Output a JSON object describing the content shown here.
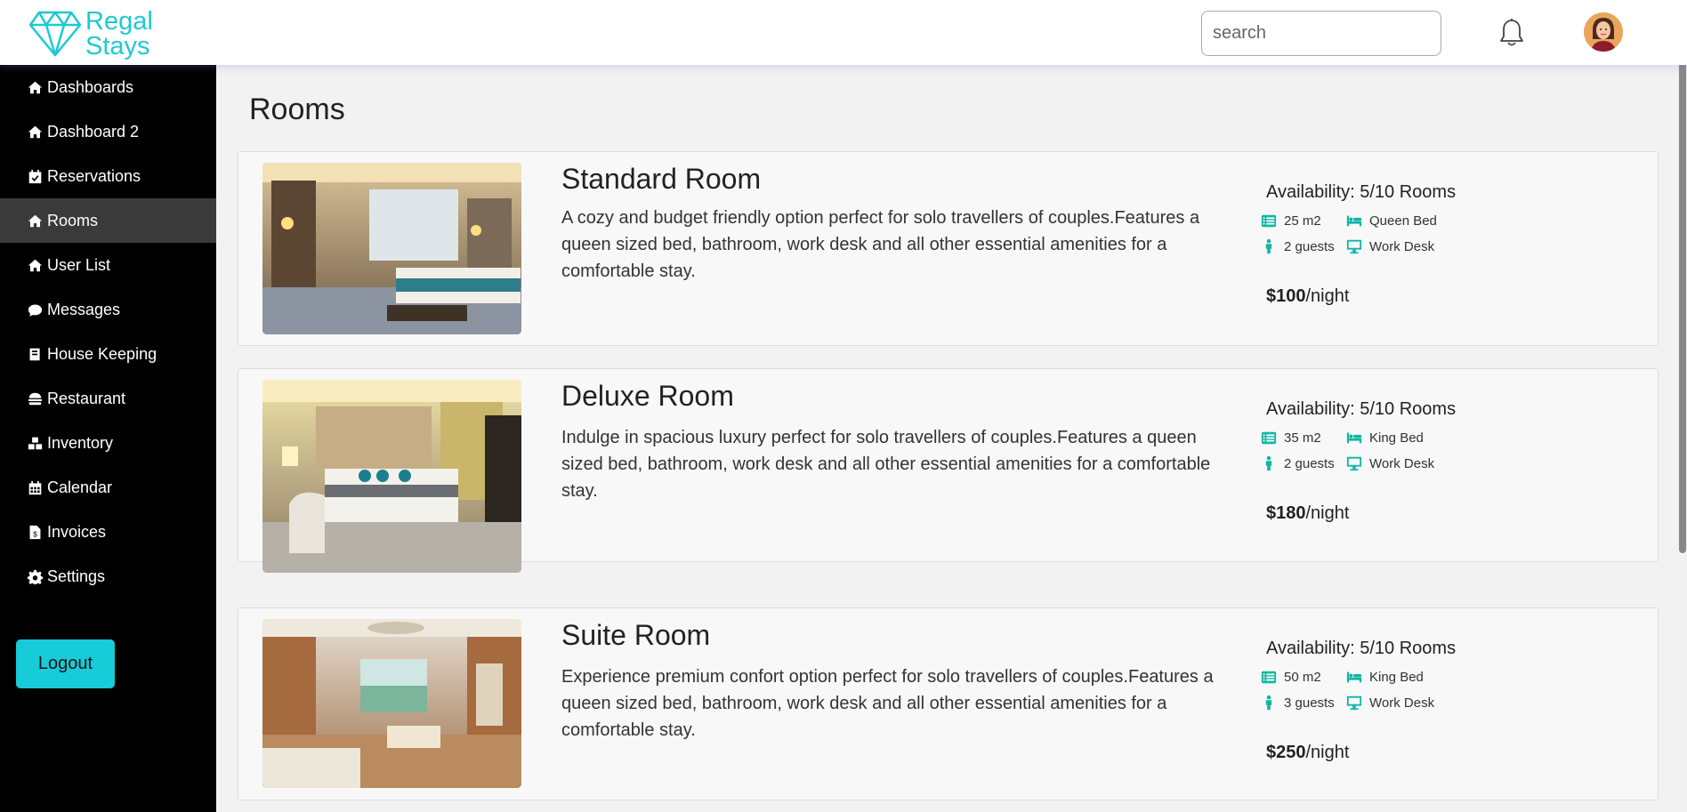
{
  "brand": {
    "line1": "Regal",
    "line2": "Stays",
    "color": "#1ec9d3"
  },
  "search": {
    "placeholder": "search"
  },
  "sidebar": {
    "items": [
      {
        "label": "Dashboards",
        "icon": "home-icon"
      },
      {
        "label": "Dashboard 2",
        "icon": "home-icon"
      },
      {
        "label": "Reservations",
        "icon": "calendar-check-icon"
      },
      {
        "label": "Rooms",
        "icon": "home-icon",
        "active": true
      },
      {
        "label": "User List",
        "icon": "home-icon"
      },
      {
        "label": "Messages",
        "icon": "chat-bubble-icon"
      },
      {
        "label": "House Keeping",
        "icon": "book-icon"
      },
      {
        "label": "Restaurant",
        "icon": "burger-icon"
      },
      {
        "label": "Inventory",
        "icon": "boxes-icon"
      },
      {
        "label": "Calendar",
        "icon": "calendar-icon"
      },
      {
        "label": "Invoices",
        "icon": "invoice-icon"
      },
      {
        "label": "Settings",
        "icon": "gear-icon"
      }
    ],
    "logout_label": "Logout"
  },
  "page": {
    "title": "Rooms"
  },
  "rooms": [
    {
      "name": "Standard Room",
      "description": "A cozy and budget friendly option perfect for solo travellers of couples.Features a queen sized bed, bathroom, work desk and all other essential amenities for a comfortable stay.",
      "availability": "Availability: 5/10 Rooms",
      "size": "25 m2",
      "bed": "Queen Bed",
      "guests": "2 guests",
      "desk": "Work Desk",
      "price": "$100",
      "price_unit": "/night"
    },
    {
      "name": "Deluxe Room",
      "description": "Indulge in spacious luxury perfect for solo travellers of couples.Features a queen sized bed, bathroom, work desk and all other essential amenities for a comfortable stay.",
      "availability": "Availability: 5/10 Rooms",
      "size": "35 m2",
      "bed": "King Bed",
      "guests": "2 guests",
      "desk": "Work Desk",
      "price": "$180",
      "price_unit": "/night"
    },
    {
      "name": "Suite Room",
      "description": "Experience premium confort option perfect for solo travellers of couples.Features a queen sized bed, bathroom, work desk and all other essential amenities for a comfortable stay.",
      "availability": "Availability: 5/10 Rooms",
      "size": "50 m2",
      "bed": "King Bed",
      "guests": "3 guests",
      "desk": "Work Desk",
      "price": "$250",
      "price_unit": "/night"
    }
  ],
  "colors": {
    "accent": "#17cbd8",
    "icon_teal": "#10b6a4",
    "sidebar_bg": "#000000",
    "active_bg": "#3a3a3a"
  }
}
